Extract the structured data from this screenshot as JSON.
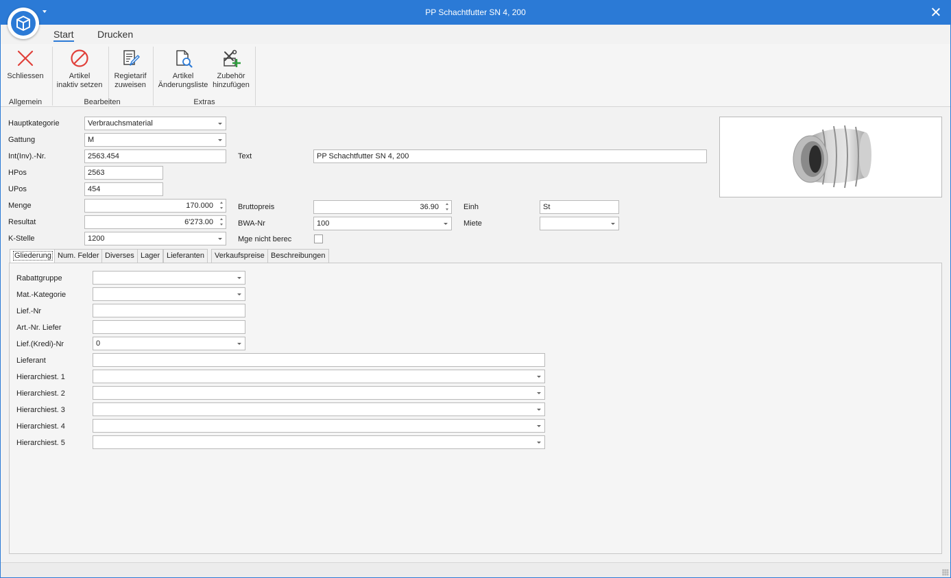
{
  "window": {
    "title": "PP Schachtfutter SN 4, 200"
  },
  "ribbon_tabs": [
    "Start",
    "Drucken"
  ],
  "ribbon": {
    "buttons": {
      "schliessen": {
        "line1": "Schliessen",
        "line2": ""
      },
      "inaktiv": {
        "line1": "Artikel",
        "line2": "inaktiv setzen"
      },
      "regietarif": {
        "line1": "Regietarif",
        "line2": "zuweisen"
      },
      "aenderungsliste": {
        "line1": "Artikel",
        "line2": "Änderungsliste"
      },
      "zubehoer": {
        "line1": "Zubehör",
        "line2": "hinzufügen"
      }
    },
    "groups": {
      "allgemein": "Allgemein",
      "bearbeiten": "Bearbeiten",
      "extras": "Extras"
    }
  },
  "form": {
    "hauptkategorie": {
      "label": "Hauptkategorie",
      "value": "Verbrauchsmaterial"
    },
    "gattung": {
      "label": "Gattung",
      "value": "M"
    },
    "intnr": {
      "label": "Int(Inv).-Nr.",
      "value": "2563.454"
    },
    "text": {
      "label": "Text",
      "value": "PP Schachtfutter SN 4, 200"
    },
    "hpos": {
      "label": "HPos",
      "value": "2563"
    },
    "upos": {
      "label": "UPos",
      "value": "454"
    },
    "menge": {
      "label": "Menge",
      "value": "170.000"
    },
    "bruttopreis": {
      "label": "Bruttopreis",
      "value": "36.90"
    },
    "einh": {
      "label": "Einh",
      "value": "St"
    },
    "resultat": {
      "label": "Resultat",
      "value": "6'273.00"
    },
    "bwanr": {
      "label": "BWA-Nr",
      "value": "100"
    },
    "miete": {
      "label": "Miete",
      "value": ""
    },
    "kstelle": {
      "label": "K-Stelle",
      "value": "1200"
    },
    "mge_nicht_berec": {
      "label": "Mge nicht berec",
      "checked": false
    }
  },
  "tabs": [
    "Gliederung",
    "Num. Felder",
    "Diverses",
    "Lager",
    "Lieferanten",
    "Verkaufspreise",
    "Beschreibungen"
  ],
  "gliederung": {
    "rabattgruppe": {
      "label": "Rabattgruppe",
      "value": ""
    },
    "matkategorie": {
      "label": "Mat.-Kategorie",
      "value": ""
    },
    "liefnr": {
      "label": "Lief.-Nr",
      "value": ""
    },
    "artnr_liefer": {
      "label": "Art.-Nr. Liefer",
      "value": ""
    },
    "liefkredinr": {
      "label": "Lief.(Kredi)-Nr",
      "value": "0"
    },
    "lieferant": {
      "label": "Lieferant",
      "value": ""
    },
    "hierarchie": [
      {
        "label": "Hierarchiest. 1",
        "value": ""
      },
      {
        "label": "Hierarchiest. 2",
        "value": ""
      },
      {
        "label": "Hierarchiest. 3",
        "value": ""
      },
      {
        "label": "Hierarchiest. 4",
        "value": ""
      },
      {
        "label": "Hierarchiest. 5",
        "value": ""
      }
    ]
  },
  "colors": {
    "accent": "#2b7ad6",
    "close_red": "#e0403a",
    "add_green": "#2e9e3e"
  }
}
